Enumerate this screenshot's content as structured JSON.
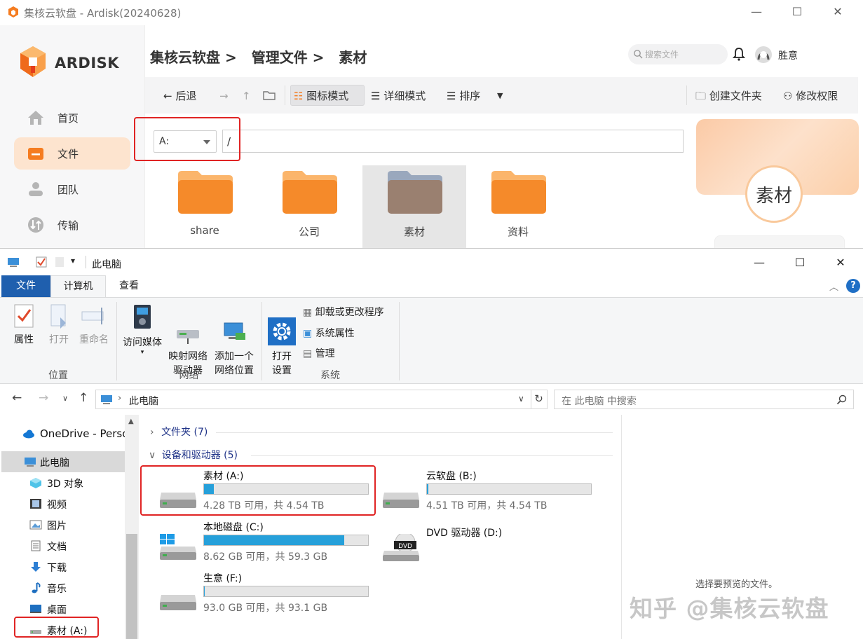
{
  "ardisk": {
    "window_title": "集核云软盘 - Ardisk(20240628)",
    "logo_text": "ARDISK",
    "nav": [
      {
        "label": "首页",
        "icon": "home-icon"
      },
      {
        "label": "文件",
        "icon": "folder-icon",
        "active": true
      },
      {
        "label": "团队",
        "icon": "team-icon"
      },
      {
        "label": "传输",
        "icon": "transfer-icon"
      }
    ],
    "breadcrumb": [
      "集核云软盘 >",
      "管理文件 >",
      "素材"
    ],
    "search_placeholder": "搜索文件",
    "user_name": "胜意",
    "toolbar": {
      "back": "← 后退",
      "icon_mode": "图标模式",
      "detail_mode": "详细模式",
      "sort": "排序",
      "create_folder": "创建文件夹",
      "modify_permission": "修改权限"
    },
    "drive_select": "A:",
    "path": "/",
    "folders": [
      "share",
      "公司",
      "素材",
      "资料"
    ],
    "panel_title": "素材",
    "brand_color": "#f57c20"
  },
  "explorer": {
    "title": "此电脑",
    "tabs": [
      "文件",
      "计算机",
      "查看"
    ],
    "ribbon": {
      "location": {
        "label": "位置",
        "items": [
          "属性",
          "打开",
          "重命名"
        ]
      },
      "network": {
        "label": "网络",
        "items": [
          "访问媒体",
          "映射网络\n驱动器",
          "添加一个\n网络位置"
        ]
      },
      "system": {
        "label": "系统",
        "open_settings": "打开\n设置",
        "items": [
          "卸载或更改程序",
          "系统属性",
          "管理"
        ]
      }
    },
    "address": "此电脑",
    "search_placeholder": "在 此电脑 中搜索",
    "tree": [
      {
        "label": "OneDrive - Perso",
        "icon": "onedrive-icon"
      },
      {
        "label": "此电脑",
        "icon": "computer-icon",
        "selected": true
      },
      {
        "label": "3D 对象",
        "icon": "3d-objects-icon"
      },
      {
        "label": "视频",
        "icon": "video-icon"
      },
      {
        "label": "图片",
        "icon": "pictures-icon"
      },
      {
        "label": "文档",
        "icon": "documents-icon"
      },
      {
        "label": "下载",
        "icon": "download-icon"
      },
      {
        "label": "音乐",
        "icon": "music-icon"
      },
      {
        "label": "桌面",
        "icon": "desktop-icon"
      },
      {
        "label": "素材 (A:)",
        "icon": "drive-icon"
      }
    ],
    "groups": {
      "folders": "文件夹 (7)",
      "devices": "设备和驱动器 (5)"
    },
    "drives": [
      {
        "name": "素材 (A:)",
        "sub": "4.28 TB 可用，共 4.54 TB",
        "used_fraction": 0.06
      },
      {
        "name": "云软盘 (B:)",
        "sub": "4.51 TB 可用，共 4.54 TB",
        "used_fraction": 0.01
      },
      {
        "name": "本地磁盘 (C:)",
        "sub": "8.62 GB 可用，共 59.3 GB",
        "used_fraction": 0.855
      },
      {
        "name": "DVD 驱动器 (D:)",
        "sub": "",
        "used_fraction": null
      },
      {
        "name": "生意 (F:)",
        "sub": "93.0 GB 可用，共 93.1 GB",
        "used_fraction": 0.001
      }
    ],
    "preview_text": "选择要预览的文件。",
    "watermark": "知乎 @集核云软盘"
  }
}
